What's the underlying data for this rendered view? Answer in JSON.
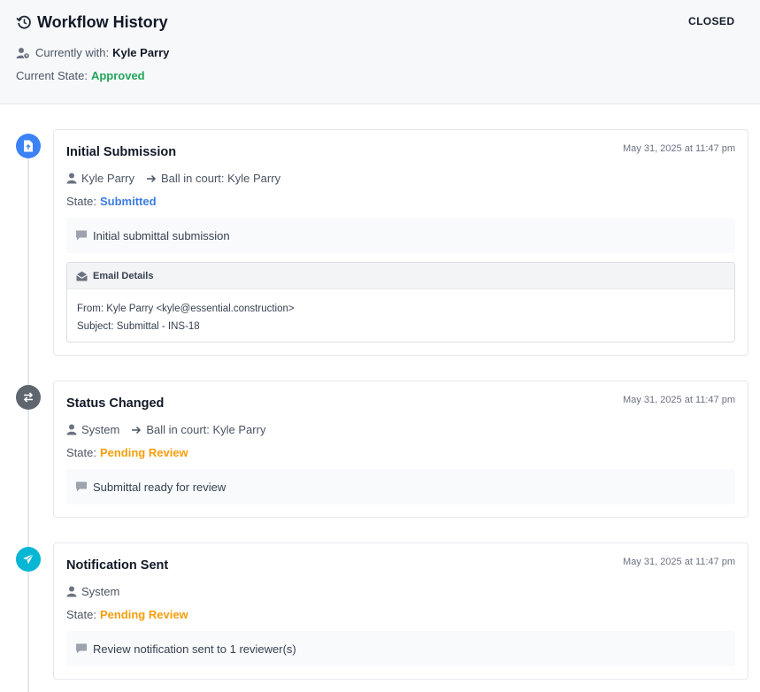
{
  "header": {
    "title": "Workflow History",
    "status": "CLOSED",
    "currently_with_label": "Currently with:",
    "currently_with_name": "Kyle Parry",
    "state_label": "Current State:",
    "state_value": "Approved",
    "state_color": "#22a55a"
  },
  "events": [
    {
      "icon": "document-icon",
      "icon_color": "#3b82f6",
      "title": "Initial Submission",
      "timestamp": "May 31, 2025 at 11:47 pm",
      "actor": "Kyle Parry",
      "ball_in_court": "Ball in court: Kyle Parry",
      "state_label": "State:",
      "state": "Submitted",
      "state_color": "#3b7be0",
      "comment": "Initial submittal submission",
      "email": {
        "heading": "Email Details",
        "from": "From: Kyle Parry <kyle@essential.construction>",
        "subject": "Subject: Submittal - INS-18"
      }
    },
    {
      "icon": "swap-arrows-icon",
      "icon_color": "#5f6670",
      "title": "Status Changed",
      "timestamp": "May 31, 2025 at 11:47 pm",
      "actor": "System",
      "ball_in_court": "Ball in court: Kyle Parry",
      "state_label": "State:",
      "state": "Pending Review",
      "state_color": "#f59e0b",
      "comment": "Submittal ready for review"
    },
    {
      "icon": "paper-plane-icon",
      "icon_color": "#06b6d4",
      "title": "Notification Sent",
      "timestamp": "May 31, 2025 at 11:47 pm",
      "actor": "System",
      "state_label": "State:",
      "state": "Pending Review",
      "state_color": "#f59e0b",
      "comment": "Review notification sent to 1 reviewer(s)"
    }
  ]
}
